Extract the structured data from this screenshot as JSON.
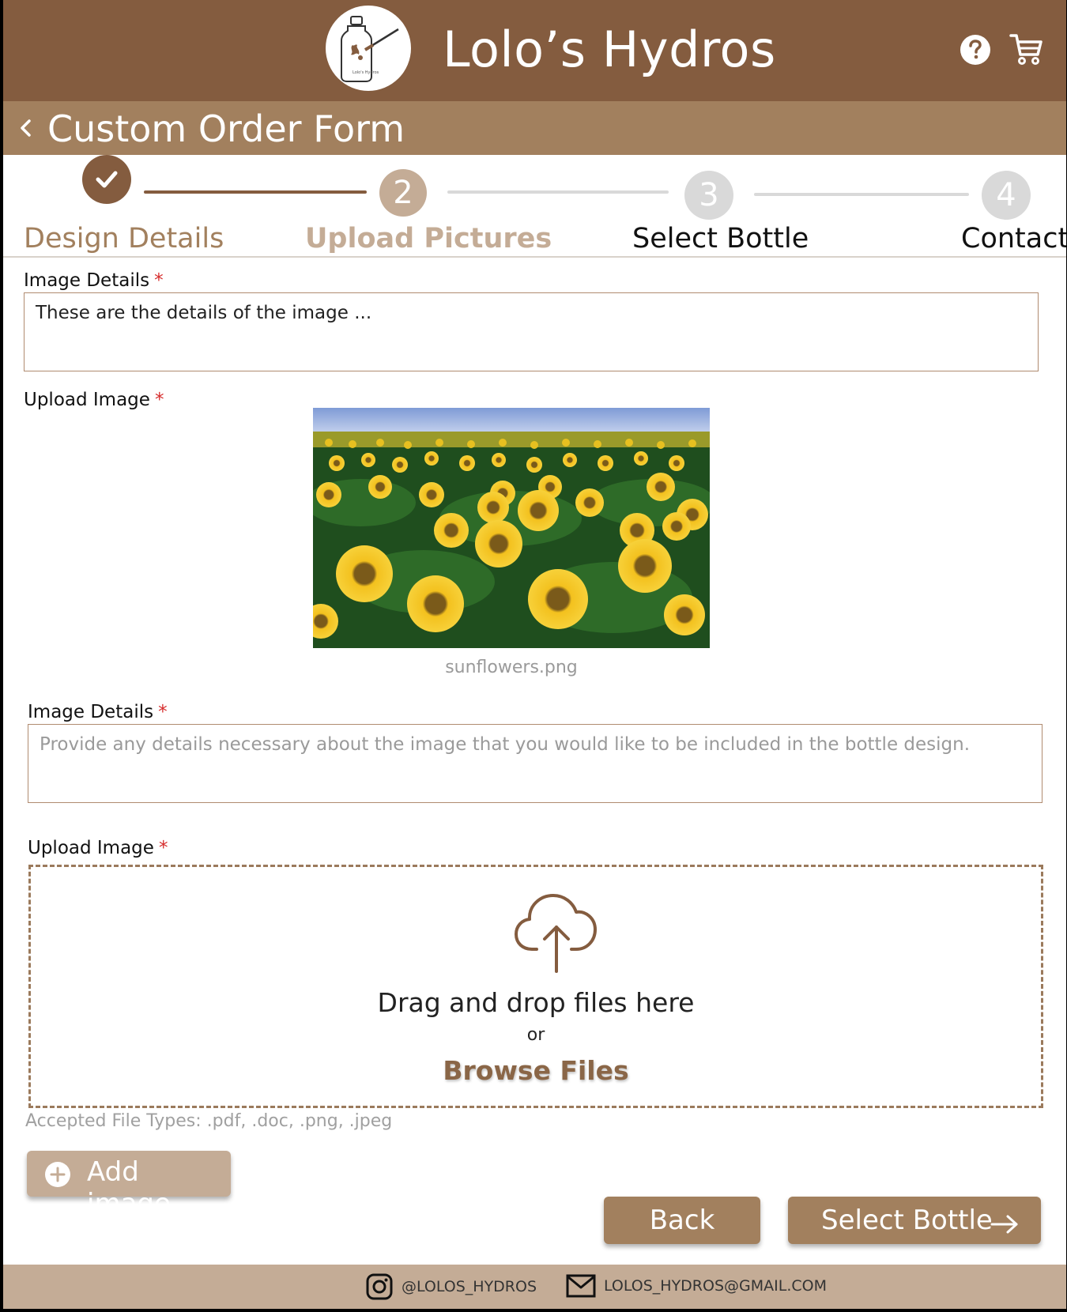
{
  "header": {
    "brand": "Lolo’s Hydros",
    "logo_icon": "bottle-logo-icon",
    "help_icon": "help-icon",
    "cart_icon": "cart-icon",
    "bg_color": "#845c3f"
  },
  "subheader": {
    "title": "Custom Order Form",
    "back_icon": "chevron-left-icon",
    "bg_color": "#a2805e"
  },
  "stepper": {
    "steps": [
      {
        "number": "✓",
        "label": "Design Details",
        "state": "complete"
      },
      {
        "number": "2",
        "label": "Upload Pictures",
        "state": "current"
      },
      {
        "number": "3",
        "label": "Select Bottle",
        "state": "upcoming"
      },
      {
        "number": "4",
        "label": "Contact",
        "state": "upcoming"
      }
    ]
  },
  "form": {
    "first_details": {
      "label": "Image Details",
      "required_mark": "*",
      "value": "These are the details of the image ..."
    },
    "first_upload": {
      "label": "Upload Image",
      "required_mark": "*",
      "filename": "sunflowers.png"
    },
    "second_details": {
      "label": "Image Details",
      "required_mark": "*",
      "placeholder": "Provide any details necessary about the image that you would like to be included in the bottle design."
    },
    "second_upload": {
      "label": "Upload Image",
      "required_mark": "*",
      "drop_text": "Drag and drop files here",
      "or_text": "or",
      "browse_label": "Browse Files",
      "accepted_types": "Accepted File Types: .pdf, .doc, .png, .jpeg"
    },
    "add_image_label": "Add image"
  },
  "actions": {
    "back_label": "Back",
    "next_label": "Select Bottle"
  },
  "footer": {
    "instagram": "@LOLOS_HYDROS",
    "email": "LOLOS_HYDROS@GMAIL.COM"
  }
}
